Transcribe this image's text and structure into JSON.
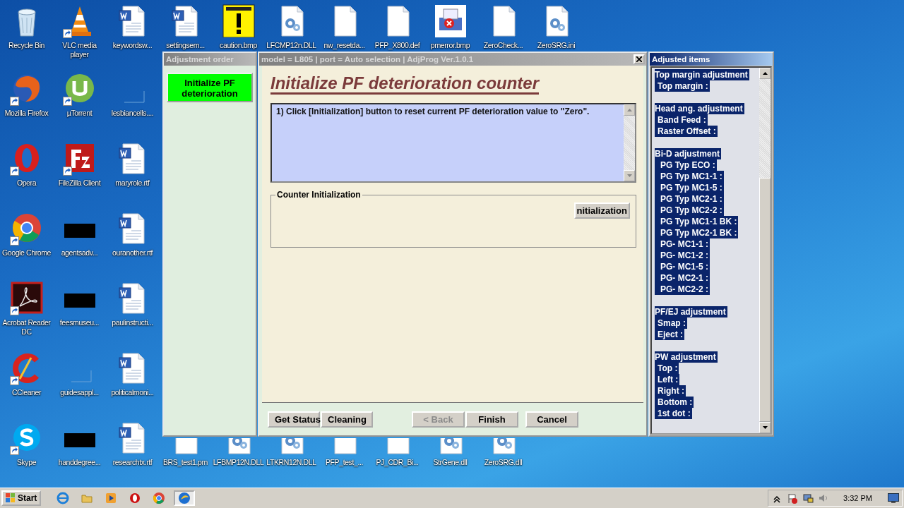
{
  "desktop": {
    "top_row": [
      {
        "label": "Recycle Bin",
        "kind": "recycle",
        "shortcut": false
      },
      {
        "label": "VLC media player",
        "kind": "vlc",
        "shortcut": true
      },
      {
        "label": "keywordsw...",
        "kind": "word",
        "shortcut": false
      },
      {
        "label": "settingsem...",
        "kind": "word",
        "shortcut": false
      },
      {
        "label": "caution.bmp",
        "kind": "caution",
        "shortcut": false
      },
      {
        "label": "LFCMP12n.DLL",
        "kind": "gear",
        "shortcut": false
      },
      {
        "label": "nw_resetda...",
        "kind": "blank",
        "shortcut": false
      },
      {
        "label": "PFP_X800.def",
        "kind": "blank",
        "shortcut": false
      },
      {
        "label": "prnerror.bmp",
        "kind": "printer",
        "shortcut": false
      },
      {
        "label": "ZeroCheck...",
        "kind": "blank",
        "shortcut": false
      },
      {
        "label": "ZeroSRG.ini",
        "kind": "gear",
        "shortcut": false
      }
    ],
    "rows": [
      [
        {
          "label": "Mozilla Firefox",
          "kind": "firefox",
          "shortcut": true
        },
        {
          "label": "µTorrent",
          "kind": "utorrent",
          "shortcut": true
        },
        {
          "label": "lesbiancells....",
          "kind": "faint",
          "shortcut": false
        }
      ],
      [
        {
          "label": "Opera",
          "kind": "opera",
          "shortcut": true
        },
        {
          "label": "FileZilla Client",
          "kind": "filezilla",
          "shortcut": true
        },
        {
          "label": "maryrole.rtf",
          "kind": "word",
          "shortcut": false
        }
      ],
      [
        {
          "label": "Google Chrome",
          "kind": "chrome",
          "shortcut": true
        },
        {
          "label": "agentsadv...",
          "kind": "black",
          "shortcut": false
        },
        {
          "label": "ouranother.rtf",
          "kind": "word",
          "shortcut": false
        }
      ],
      [
        {
          "label": "Acrobat Reader DC",
          "kind": "acrobat",
          "shortcut": true
        },
        {
          "label": "feesmuseu...",
          "kind": "black",
          "shortcut": false
        },
        {
          "label": "paulinstructi...",
          "kind": "word",
          "shortcut": false
        }
      ],
      [
        {
          "label": "CCleaner",
          "kind": "ccleaner",
          "shortcut": true
        },
        {
          "label": "guidesappl...",
          "kind": "faint",
          "shortcut": false
        },
        {
          "label": "politicalmoni...",
          "kind": "word",
          "shortcut": false
        }
      ],
      [
        {
          "label": "Skype",
          "kind": "skype",
          "shortcut": true
        },
        {
          "label": "handdegree...",
          "kind": "black",
          "shortcut": false
        },
        {
          "label": "researchtx.rtf",
          "kind": "word",
          "shortcut": false
        },
        {
          "label": "BRS_test1.prn",
          "kind": "blank",
          "shortcut": false
        },
        {
          "label": "LFBMP12N.DLL",
          "kind": "gear",
          "shortcut": false
        },
        {
          "label": "LTKRN12N.DLL",
          "kind": "gear",
          "shortcut": false
        },
        {
          "label": "PFP_test_...",
          "kind": "blank",
          "shortcut": false
        },
        {
          "label": "PJ_CDR_Bi...",
          "kind": "blank",
          "shortcut": false
        },
        {
          "label": "StrGene.dll",
          "kind": "gear",
          "shortcut": false
        },
        {
          "label": "ZeroSRG.dll",
          "kind": "gear",
          "shortcut": false
        }
      ]
    ]
  },
  "adjustment_order": {
    "title": "Adjustment order",
    "active": false,
    "steps": [
      {
        "label": "Initialize PF deterioration",
        "selected": true
      }
    ]
  },
  "main_window": {
    "title": "model = L805 | port = Auto selection | AdjProg Ver.1.0.1",
    "active": false,
    "heading": "Initialize PF deterioration counter",
    "instructions": "1) Click [Initialization] button to reset current PF deterioration value to \"Zero\".",
    "group": {
      "title": "Counter Initialization",
      "button": "nitialization"
    },
    "buttons": [
      {
        "label": "Get Status",
        "disabled": false
      },
      {
        "label": "Cleaning",
        "disabled": false
      },
      {
        "label": "< Back",
        "disabled": true
      },
      {
        "label": "Finish",
        "disabled": false
      },
      {
        "label": "Cancel",
        "disabled": false
      }
    ]
  },
  "adjusted_items": {
    "title": "Adjusted items",
    "active": true,
    "groups": [
      {
        "heading": "Top margin adjustment",
        "items": [
          "Top margin :"
        ]
      },
      {
        "heading": "Head ang. adjustment",
        "items": [
          "Band Feed :",
          "Raster Offset :"
        ]
      },
      {
        "heading": "Bi-D adjustment",
        "items": [
          "PG Typ ECO :",
          "PG Typ MC1-1 :",
          "PG Typ MC1-5 :",
          "PG Typ MC2-1 :",
          "PG Typ MC2-2 :",
          "PG Typ MC1-1 BK :",
          "PG Typ MC2-1 BK :",
          "PG- MC1-1 :",
          "PG- MC1-2 :",
          "PG- MC1-5 :",
          "PG- MC2-1 :",
          "PG- MC2-2 :"
        ]
      },
      {
        "heading": "PF/EJ adjustment",
        "items": [
          "Smap :",
          "Eject :"
        ]
      },
      {
        "heading": "PW adjustment",
        "items": [
          "Top :",
          "Left :",
          "Right :",
          "Bottom :",
          "1st dot :"
        ]
      }
    ]
  },
  "taskbar": {
    "start": "Start",
    "apps": [
      {
        "kind": "ie",
        "selected": false
      },
      {
        "kind": "folder",
        "selected": false
      },
      {
        "kind": "media",
        "selected": false
      },
      {
        "kind": "opera",
        "selected": false
      },
      {
        "kind": "chrome",
        "selected": false
      },
      {
        "kind": "adjprog",
        "selected": true
      }
    ],
    "clock": "3:32 PM"
  }
}
